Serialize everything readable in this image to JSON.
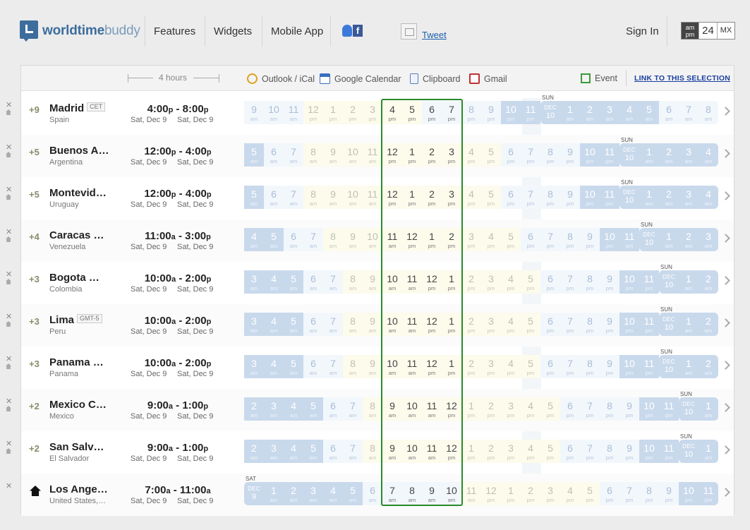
{
  "header": {
    "logo_primary": "worldtime",
    "logo_secondary": "buddy",
    "nav": [
      "Features",
      "Widgets",
      "Mobile App"
    ],
    "social_icon_text": "f",
    "tweet_label": "Tweet",
    "sign_in": "Sign In",
    "time_format": {
      "ampm_top": "am",
      "ampm_bottom": "pm",
      "h24": "24",
      "mx": "MX"
    }
  },
  "toolbar": {
    "span_label": "4 hours",
    "tools": [
      "Outlook / iCal",
      "Google Calendar",
      "Clipboard",
      "Gmail"
    ],
    "event_label": "Event",
    "link_label": "LINK TO THIS SELECTION"
  },
  "colors": {
    "selection": "#2a8a2a",
    "night": "#c9d9ec",
    "day": "#fcfbec",
    "link": "#1b3fa0"
  },
  "rows": [
    {
      "offset": "+9",
      "city": "Madrid",
      "tz": "CET",
      "country": "Spain",
      "from": "4:00",
      "from_s": "p",
      "to": "8:00",
      "to_s": "p",
      "date_from": "Sat, Dec 9",
      "date_to": "Sat, Dec 9",
      "hours": [
        "9",
        "10",
        "11",
        "12",
        "1",
        "2",
        "3",
        "4",
        "5",
        "6",
        "7",
        "8",
        "9",
        "10",
        "11",
        "DEC|10",
        "1",
        "2",
        "3",
        "4",
        "5",
        "6",
        "7",
        "8"
      ],
      "mers": [
        "am",
        "am",
        "am",
        "pm",
        "pm",
        "pm",
        "pm",
        "pm",
        "pm",
        "pm",
        "pm",
        "pm",
        "pm",
        "pm",
        "pm",
        "",
        "am",
        "am",
        "am",
        "am",
        "am",
        "am",
        "am",
        "am"
      ],
      "kinds": [
        "o",
        "o",
        "o",
        "d",
        "d",
        "d",
        "d",
        "d",
        "d",
        "o",
        "o",
        "o",
        "o",
        "n",
        "n",
        "m",
        "n",
        "n",
        "n",
        "n",
        "n",
        "o",
        "o",
        "o"
      ],
      "day_label": "SUN",
      "day_label_index": 15
    },
    {
      "offset": "+5",
      "city": "Buenos A…",
      "tz": "",
      "country": "Argentina",
      "from": "12:00",
      "from_s": "p",
      "to": "4:00",
      "to_s": "p",
      "date_from": "Sat, Dec 9",
      "date_to": "Sat, Dec 9",
      "hours": [
        "5",
        "6",
        "7",
        "8",
        "9",
        "10",
        "11",
        "12",
        "1",
        "2",
        "3",
        "4",
        "5",
        "6",
        "7",
        "8",
        "9",
        "10",
        "11",
        "DEC|10",
        "1",
        "2",
        "3",
        "4"
      ],
      "mers": [
        "am",
        "am",
        "am",
        "am",
        "am",
        "am",
        "am",
        "pm",
        "pm",
        "pm",
        "pm",
        "pm",
        "pm",
        "pm",
        "pm",
        "pm",
        "pm",
        "pm",
        "pm",
        "",
        "am",
        "am",
        "am",
        "am"
      ],
      "kinds": [
        "n",
        "o",
        "o",
        "d",
        "d",
        "d",
        "d",
        "d",
        "d",
        "d",
        "d",
        "d",
        "d",
        "o",
        "o",
        "o",
        "o",
        "n",
        "n",
        "m",
        "n",
        "n",
        "n",
        "n"
      ],
      "day_label": "SUN",
      "day_label_index": 19
    },
    {
      "offset": "+5",
      "city": "Montevid…",
      "tz": "",
      "country": "Uruguay",
      "from": "12:00",
      "from_s": "p",
      "to": "4:00",
      "to_s": "p",
      "date_from": "Sat, Dec 9",
      "date_to": "Sat, Dec 9",
      "hours": [
        "5",
        "6",
        "7",
        "8",
        "9",
        "10",
        "11",
        "12",
        "1",
        "2",
        "3",
        "4",
        "5",
        "6",
        "7",
        "8",
        "9",
        "10",
        "11",
        "DEC|10",
        "1",
        "2",
        "3",
        "4"
      ],
      "mers": [
        "am",
        "am",
        "am",
        "am",
        "am",
        "am",
        "am",
        "pm",
        "pm",
        "pm",
        "pm",
        "pm",
        "pm",
        "pm",
        "pm",
        "pm",
        "pm",
        "pm",
        "pm",
        "",
        "am",
        "am",
        "am",
        "am"
      ],
      "kinds": [
        "n",
        "o",
        "o",
        "d",
        "d",
        "d",
        "d",
        "d",
        "d",
        "d",
        "d",
        "d",
        "d",
        "o",
        "o",
        "o",
        "o",
        "n",
        "n",
        "m",
        "n",
        "n",
        "n",
        "n"
      ],
      "day_label": "SUN",
      "day_label_index": 19
    },
    {
      "offset": "+4",
      "city": "Caracas …",
      "tz": "",
      "country": "Venezuela",
      "from": "11:00",
      "from_s": "a",
      "to": "3:00",
      "to_s": "p",
      "date_from": "Sat, Dec 9",
      "date_to": "Sat, Dec 9",
      "hours": [
        "4",
        "5",
        "6",
        "7",
        "8",
        "9",
        "10",
        "11",
        "12",
        "1",
        "2",
        "3",
        "4",
        "5",
        "6",
        "7",
        "8",
        "9",
        "10",
        "11",
        "DEC|10",
        "1",
        "2",
        "3"
      ],
      "mers": [
        "am",
        "am",
        "am",
        "am",
        "am",
        "am",
        "am",
        "am",
        "pm",
        "pm",
        "pm",
        "pm",
        "pm",
        "pm",
        "pm",
        "pm",
        "pm",
        "pm",
        "pm",
        "pm",
        "",
        "am",
        "am",
        "am"
      ],
      "kinds": [
        "n",
        "n",
        "o",
        "o",
        "d",
        "d",
        "d",
        "d",
        "d",
        "d",
        "d",
        "d",
        "d",
        "d",
        "o",
        "o",
        "o",
        "o",
        "n",
        "n",
        "m",
        "n",
        "n",
        "n"
      ],
      "day_label": "SUN",
      "day_label_index": 20
    },
    {
      "offset": "+3",
      "city": "Bogota …",
      "tz": "",
      "country": "Colombia",
      "from": "10:00",
      "from_s": "a",
      "to": "2:00",
      "to_s": "p",
      "date_from": "Sat, Dec 9",
      "date_to": "Sat, Dec 9",
      "hours": [
        "3",
        "4",
        "5",
        "6",
        "7",
        "8",
        "9",
        "10",
        "11",
        "12",
        "1",
        "2",
        "3",
        "4",
        "5",
        "6",
        "7",
        "8",
        "9",
        "10",
        "11",
        "DEC|10",
        "1",
        "2"
      ],
      "mers": [
        "am",
        "am",
        "am",
        "am",
        "am",
        "am",
        "am",
        "am",
        "am",
        "pm",
        "pm",
        "pm",
        "pm",
        "pm",
        "pm",
        "pm",
        "pm",
        "pm",
        "pm",
        "pm",
        "pm",
        "",
        "am",
        "am"
      ],
      "kinds": [
        "n",
        "n",
        "n",
        "o",
        "o",
        "d",
        "d",
        "d",
        "d",
        "d",
        "d",
        "d",
        "d",
        "d",
        "d",
        "o",
        "o",
        "o",
        "o",
        "n",
        "n",
        "m",
        "n",
        "n"
      ],
      "day_label": "SUN",
      "day_label_index": 21
    },
    {
      "offset": "+3",
      "city": "Lima",
      "tz": "GMT-5",
      "country": "Peru",
      "from": "10:00",
      "from_s": "a",
      "to": "2:00",
      "to_s": "p",
      "date_from": "Sat, Dec 9",
      "date_to": "Sat, Dec 9",
      "hours": [
        "3",
        "4",
        "5",
        "6",
        "7",
        "8",
        "9",
        "10",
        "11",
        "12",
        "1",
        "2",
        "3",
        "4",
        "5",
        "6",
        "7",
        "8",
        "9",
        "10",
        "11",
        "DEC|10",
        "1",
        "2"
      ],
      "mers": [
        "am",
        "am",
        "am",
        "am",
        "am",
        "am",
        "am",
        "am",
        "am",
        "pm",
        "pm",
        "pm",
        "pm",
        "pm",
        "pm",
        "pm",
        "pm",
        "pm",
        "pm",
        "pm",
        "pm",
        "",
        "am",
        "am"
      ],
      "kinds": [
        "n",
        "n",
        "n",
        "o",
        "o",
        "d",
        "d",
        "d",
        "d",
        "d",
        "d",
        "d",
        "d",
        "d",
        "d",
        "o",
        "o",
        "o",
        "o",
        "n",
        "n",
        "m",
        "n",
        "n"
      ],
      "day_label": "SUN",
      "day_label_index": 21
    },
    {
      "offset": "+3",
      "city": "Panama …",
      "tz": "",
      "country": "Panama",
      "from": "10:00",
      "from_s": "a",
      "to": "2:00",
      "to_s": "p",
      "date_from": "Sat, Dec 9",
      "date_to": "Sat, Dec 9",
      "hours": [
        "3",
        "4",
        "5",
        "6",
        "7",
        "8",
        "9",
        "10",
        "11",
        "12",
        "1",
        "2",
        "3",
        "4",
        "5",
        "6",
        "7",
        "8",
        "9",
        "10",
        "11",
        "DEC|10",
        "1",
        "2"
      ],
      "mers": [
        "am",
        "am",
        "am",
        "am",
        "am",
        "am",
        "am",
        "am",
        "am",
        "pm",
        "pm",
        "pm",
        "pm",
        "pm",
        "pm",
        "pm",
        "pm",
        "pm",
        "pm",
        "pm",
        "pm",
        "",
        "am",
        "am"
      ],
      "kinds": [
        "n",
        "n",
        "n",
        "o",
        "o",
        "d",
        "d",
        "d",
        "d",
        "d",
        "d",
        "d",
        "d",
        "d",
        "d",
        "o",
        "o",
        "o",
        "o",
        "n",
        "n",
        "m",
        "n",
        "n"
      ],
      "day_label": "SUN",
      "day_label_index": 21
    },
    {
      "offset": "+2",
      "city": "Mexico C…",
      "tz": "",
      "country": "Mexico",
      "from": "9:00",
      "from_s": "a",
      "to": "1:00",
      "to_s": "p",
      "date_from": "Sat, Dec 9",
      "date_to": "Sat, Dec 9",
      "hours": [
        "2",
        "3",
        "4",
        "5",
        "6",
        "7",
        "8",
        "9",
        "10",
        "11",
        "12",
        "1",
        "2",
        "3",
        "4",
        "5",
        "6",
        "7",
        "8",
        "9",
        "10",
        "11",
        "DEC|10",
        "1"
      ],
      "mers": [
        "am",
        "am",
        "am",
        "am",
        "am",
        "am",
        "am",
        "am",
        "am",
        "am",
        "pm",
        "pm",
        "pm",
        "pm",
        "pm",
        "pm",
        "pm",
        "pm",
        "pm",
        "pm",
        "pm",
        "pm",
        "",
        "am"
      ],
      "kinds": [
        "n",
        "n",
        "n",
        "n",
        "o",
        "o",
        "d",
        "d",
        "d",
        "d",
        "d",
        "d",
        "d",
        "d",
        "d",
        "d",
        "o",
        "o",
        "o",
        "o",
        "n",
        "n",
        "m",
        "n"
      ],
      "day_label": "SUN",
      "day_label_index": 22
    },
    {
      "offset": "+2",
      "city": "San Salv…",
      "tz": "",
      "country": "El Salvador",
      "from": "9:00",
      "from_s": "a",
      "to": "1:00",
      "to_s": "p",
      "date_from": "Sat, Dec 9",
      "date_to": "Sat, Dec 9",
      "hours": [
        "2",
        "3",
        "4",
        "5",
        "6",
        "7",
        "8",
        "9",
        "10",
        "11",
        "12",
        "1",
        "2",
        "3",
        "4",
        "5",
        "6",
        "7",
        "8",
        "9",
        "10",
        "11",
        "DEC|10",
        "1"
      ],
      "mers": [
        "am",
        "am",
        "am",
        "am",
        "am",
        "am",
        "am",
        "am",
        "am",
        "am",
        "pm",
        "pm",
        "pm",
        "pm",
        "pm",
        "pm",
        "pm",
        "pm",
        "pm",
        "pm",
        "pm",
        "pm",
        "",
        "am"
      ],
      "kinds": [
        "n",
        "n",
        "n",
        "n",
        "o",
        "o",
        "d",
        "d",
        "d",
        "d",
        "d",
        "d",
        "d",
        "d",
        "d",
        "d",
        "o",
        "o",
        "o",
        "o",
        "n",
        "n",
        "m",
        "n"
      ],
      "day_label": "SUN",
      "day_label_index": 22
    },
    {
      "offset": "",
      "city": "Los Ange…",
      "tz": "",
      "country": "United States,…",
      "from": "7:00",
      "from_s": "a",
      "to": "11:00",
      "to_s": "a",
      "date_from": "Sat, Dec 9",
      "date_to": "Sat, Dec 9",
      "home": true,
      "hours": [
        "DEC|9",
        "1",
        "2",
        "3",
        "4",
        "5",
        "6",
        "7",
        "8",
        "9",
        "10",
        "11",
        "12",
        "1",
        "2",
        "3",
        "4",
        "5",
        "6",
        "7",
        "8",
        "9",
        "10",
        "11"
      ],
      "mers": [
        "",
        "am",
        "am",
        "am",
        "am",
        "am",
        "am",
        "am",
        "am",
        "am",
        "am",
        "am",
        "pm",
        "pm",
        "pm",
        "pm",
        "pm",
        "pm",
        "pm",
        "pm",
        "pm",
        "pm",
        "pm",
        "pm"
      ],
      "kinds": [
        "m",
        "n",
        "n",
        "n",
        "n",
        "n",
        "o",
        "o",
        "o",
        "o",
        "o",
        "d",
        "d",
        "d",
        "d",
        "d",
        "d",
        "d",
        "o",
        "o",
        "o",
        "o",
        "n",
        "n"
      ],
      "day_label": "SAT",
      "day_label_index": 0
    }
  ]
}
